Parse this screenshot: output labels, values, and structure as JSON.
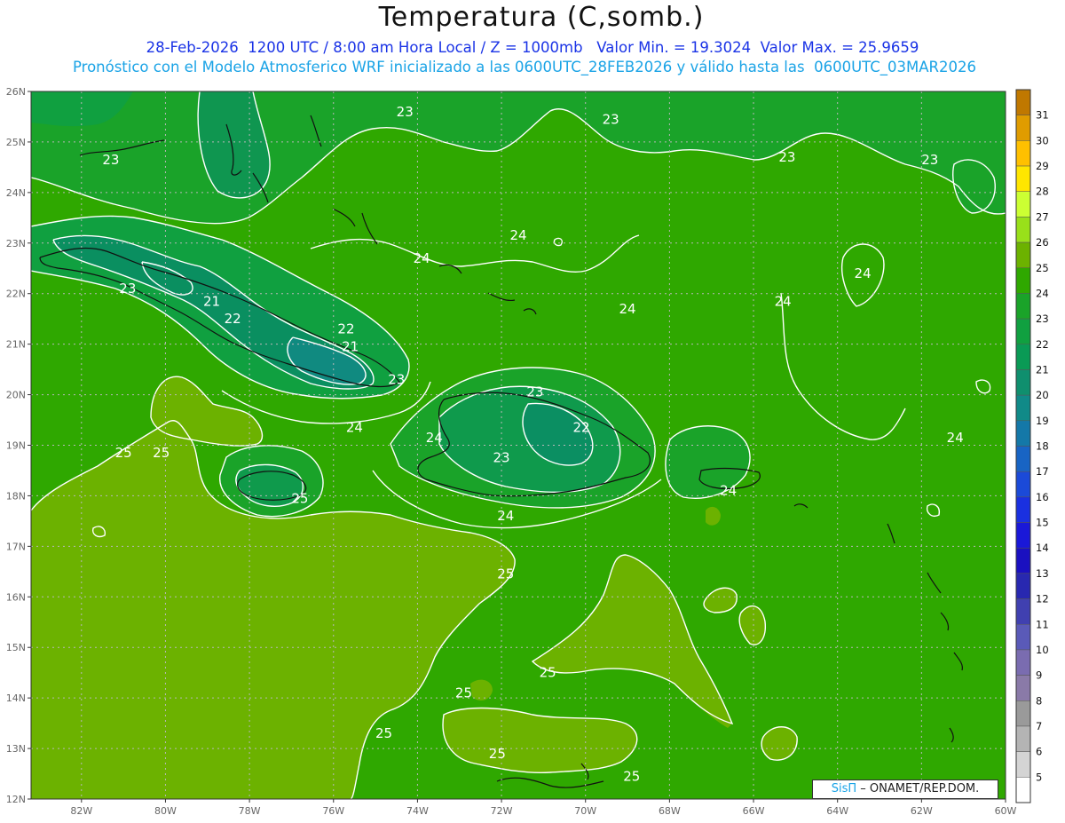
{
  "title": "Temperatura (C,somb.)",
  "subtitle_line1": "28-Feb-2026  1200 UTC / 8:00 am Hora Local / Z = 1000mb   Valor Min. = 19.3024  Valor Max. = 25.9659",
  "subtitle_line2": "Pronóstico con el Modelo Atmosferico WRF inicializado a las 0600UTC_28FEB2026 y válido hasta las  0600UTC_03MAR2026",
  "credit": {
    "brand": "SisΠ",
    "org": " – ONAMET/REP.DOM."
  },
  "map": {
    "lon_range": [
      -83.2,
      -60
    ],
    "lat_range": [
      12,
      26
    ],
    "lon_ticks": [
      "82W",
      "80W",
      "78W",
      "76W",
      "74W",
      "72W",
      "70W",
      "68W",
      "66W",
      "64W",
      "62W",
      "60W"
    ],
    "lat_ticks": [
      "26N",
      "25N",
      "24N",
      "23N",
      "22N",
      "21N",
      "20N",
      "19N",
      "18N",
      "17N",
      "16N",
      "15N",
      "14N",
      "13N",
      "12N"
    ],
    "grid": true
  },
  "colorbar": {
    "levels": [
      {
        "label": "31",
        "color": "#c07800"
      },
      {
        "label": "30",
        "color": "#e09c00"
      },
      {
        "label": "29",
        "color": "#ffc000"
      },
      {
        "label": "28",
        "color": "#ffe600"
      },
      {
        "label": "27",
        "color": "#ccff33"
      },
      {
        "label": "26",
        "color": "#99e01a"
      },
      {
        "label": "25",
        "color": "#6cb200"
      },
      {
        "label": "24",
        "color": "#2fa800"
      },
      {
        "label": "23",
        "color": "#1aa329"
      },
      {
        "label": "22",
        "color": "#10a040"
      },
      {
        "label": "21",
        "color": "#0a9a55"
      },
      {
        "label": "20",
        "color": "#0f8f6e"
      },
      {
        "label": "19",
        "color": "#108a88"
      },
      {
        "label": "18",
        "color": "#1478a8"
      },
      {
        "label": "17",
        "color": "#1864c4"
      },
      {
        "label": "16",
        "color": "#1b4ad8"
      },
      {
        "label": "15",
        "color": "#1a30e0"
      },
      {
        "label": "14",
        "color": "#1a18d8"
      },
      {
        "label": "13",
        "color": "#1a10c0"
      },
      {
        "label": "12",
        "color": "#2828b0"
      },
      {
        "label": "11",
        "color": "#4040b0"
      },
      {
        "label": "10",
        "color": "#5a5ab8"
      },
      {
        "label": "9",
        "color": "#7a6cb0"
      },
      {
        "label": "8",
        "color": "#8a7aa8"
      },
      {
        "label": "7",
        "color": "#9a9a9a"
      },
      {
        "label": "6",
        "color": "#b4b4b4"
      },
      {
        "label": "5",
        "color": "#d4d4d4"
      },
      {
        "label": "",
        "color": "#ffffff"
      }
    ]
  },
  "contour_labels": [
    {
      "text": "23",
      "lon": -74.3,
      "lat": 25.6
    },
    {
      "text": "23",
      "lon": -69.4,
      "lat": 25.45
    },
    {
      "text": "23",
      "lon": -81.3,
      "lat": 24.65
    },
    {
      "text": "23",
      "lon": -65.2,
      "lat": 24.7
    },
    {
      "text": "23",
      "lon": -61.8,
      "lat": 24.65
    },
    {
      "text": "24",
      "lon": -71.6,
      "lat": 23.15
    },
    {
      "text": "24",
      "lon": -73.9,
      "lat": 22.7
    },
    {
      "text": "24",
      "lon": -63.4,
      "lat": 22.4
    },
    {
      "text": "24",
      "lon": -65.3,
      "lat": 21.85
    },
    {
      "text": "24",
      "lon": -69.0,
      "lat": 21.7
    },
    {
      "text": "23",
      "lon": -80.9,
      "lat": 22.1
    },
    {
      "text": "21",
      "lon": -78.9,
      "lat": 21.85
    },
    {
      "text": "22",
      "lon": -78.4,
      "lat": 21.5
    },
    {
      "text": "22",
      "lon": -75.7,
      "lat": 21.3
    },
    {
      "text": "21",
      "lon": -75.6,
      "lat": 20.95
    },
    {
      "text": "23",
      "lon": -74.5,
      "lat": 20.3
    },
    {
      "text": "23",
      "lon": -71.2,
      "lat": 20.05
    },
    {
      "text": "22",
      "lon": -70.1,
      "lat": 19.35
    },
    {
      "text": "24",
      "lon": -75.5,
      "lat": 19.35
    },
    {
      "text": "24",
      "lon": -73.6,
      "lat": 19.15
    },
    {
      "text": "24",
      "lon": -61.2,
      "lat": 19.15
    },
    {
      "text": "23",
      "lon": -72.0,
      "lat": 18.75
    },
    {
      "text": "24",
      "lon": -66.6,
      "lat": 18.1
    },
    {
      "text": "24",
      "lon": -71.9,
      "lat": 17.6
    },
    {
      "text": "25",
      "lon": -81.0,
      "lat": 18.85
    },
    {
      "text": "25",
      "lon": -80.1,
      "lat": 18.85
    },
    {
      "text": "25",
      "lon": -76.8,
      "lat": 17.95
    },
    {
      "text": "25",
      "lon": -71.9,
      "lat": 16.45
    },
    {
      "text": "25",
      "lon": -70.9,
      "lat": 14.5
    },
    {
      "text": "25",
      "lon": -72.9,
      "lat": 14.1
    },
    {
      "text": "25",
      "lon": -74.8,
      "lat": 13.3
    },
    {
      "text": "25",
      "lon": -72.1,
      "lat": 12.9
    },
    {
      "text": "25",
      "lon": -68.9,
      "lat": 12.45
    }
  ]
}
